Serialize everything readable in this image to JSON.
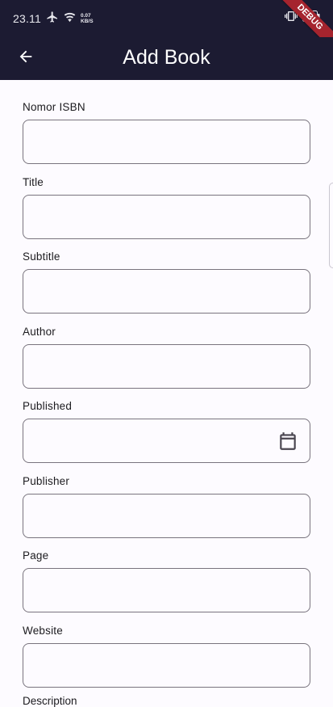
{
  "status_bar": {
    "time": "23.11",
    "speed_value": "0.07",
    "speed_unit": "KB/S"
  },
  "debug_banner": "DEBUG",
  "app_bar": {
    "title": "Add Book"
  },
  "form": {
    "fields": [
      {
        "label": "Nomor ISBN",
        "value": ""
      },
      {
        "label": "Title",
        "value": ""
      },
      {
        "label": "Subtitle",
        "value": ""
      },
      {
        "label": "Author",
        "value": ""
      },
      {
        "label": "Published",
        "value": ""
      },
      {
        "label": "Publisher",
        "value": ""
      },
      {
        "label": "Page",
        "value": ""
      },
      {
        "label": "Website",
        "value": ""
      }
    ],
    "next_label_partial": "Description"
  },
  "colors": {
    "app_bar": "#1c1b32",
    "background": "#fdfbff",
    "outline": "#79747e",
    "debug_ribbon": "#a5242e"
  }
}
